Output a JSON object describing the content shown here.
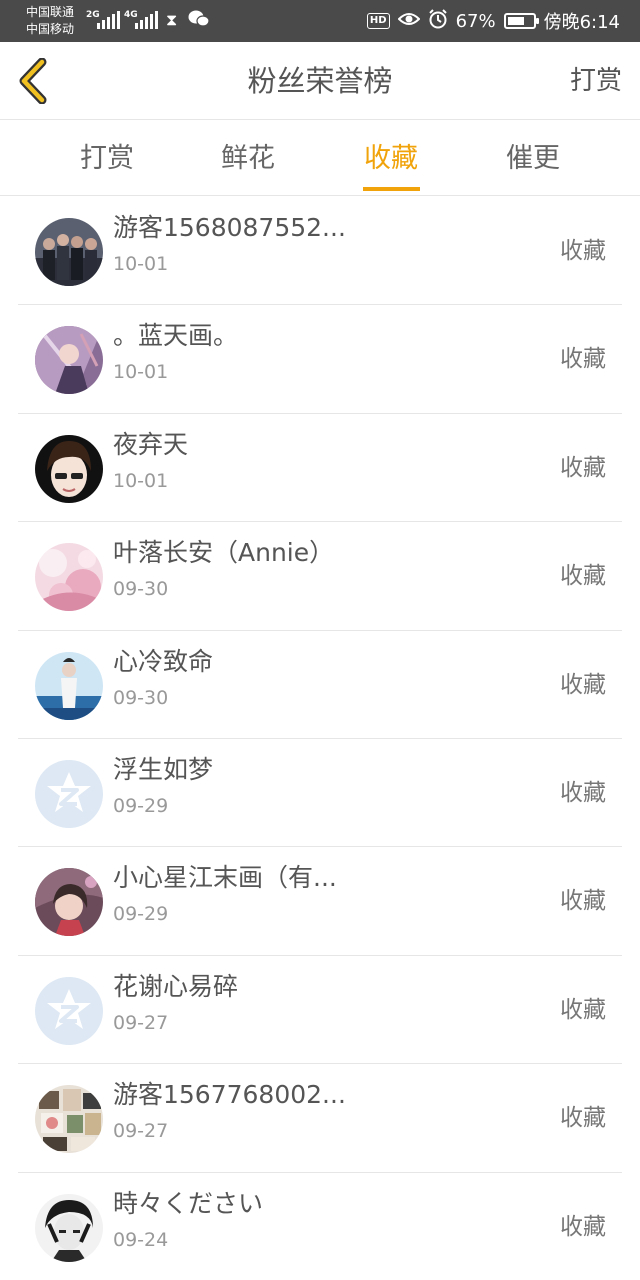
{
  "status_bar": {
    "carrier1": "中国联通",
    "carrier2": "中国移动",
    "net1": "2G",
    "net2": "4G",
    "hd": "HD",
    "battery_pct": "67%",
    "battery_level": 0.67,
    "time": "傍晚6:14"
  },
  "header": {
    "title": "粉丝荣誉榜",
    "right_label": "打赏"
  },
  "tabs": [
    {
      "label": "打赏"
    },
    {
      "label": "鲜花"
    },
    {
      "label": "收藏"
    },
    {
      "label": "催更"
    }
  ],
  "active_tab": 2,
  "accent_color": "#f0a30a",
  "fans": [
    {
      "name": "游客1568087552...",
      "date": "10-01",
      "action": "收藏",
      "avatar": "group-photo"
    },
    {
      "name": "。蓝天画。",
      "date": "10-01",
      "action": "收藏",
      "avatar": "anime-art"
    },
    {
      "name": "夜弃天",
      "date": "10-01",
      "action": "收藏",
      "avatar": "anime-boy"
    },
    {
      "name": "叶落长安（Annie）",
      "date": "09-30",
      "action": "收藏",
      "avatar": "pink-blossom"
    },
    {
      "name": "心冷致命",
      "date": "09-30",
      "action": "收藏",
      "avatar": "blue-figure"
    },
    {
      "name": "浮生如梦",
      "date": "09-29",
      "action": "收藏",
      "avatar": "default-qq"
    },
    {
      "name": "小心星江末画（有...",
      "date": "09-29",
      "action": "收藏",
      "avatar": "anime-girl"
    },
    {
      "name": "花谢心易碎",
      "date": "09-27",
      "action": "收藏",
      "avatar": "default-qq"
    },
    {
      "name": "游客1567768002...",
      "date": "09-27",
      "action": "收藏",
      "avatar": "collage"
    },
    {
      "name": "時々ください",
      "date": "09-24",
      "action": "收藏",
      "avatar": "bw-sketch"
    }
  ]
}
